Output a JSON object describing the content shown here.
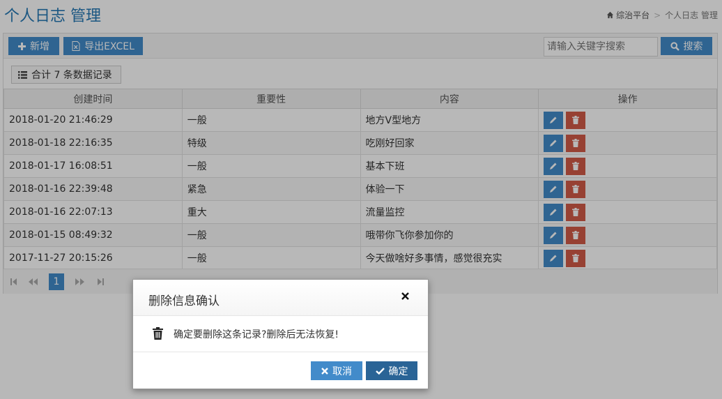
{
  "header": {
    "title": "个人日志 管理",
    "breadcrumb": {
      "home": "综治平台",
      "separator": ">",
      "current": "个人日志 管理"
    }
  },
  "toolbar": {
    "add_label": "新增",
    "export_label": "导出EXCEL",
    "search_placeholder": "请输入关键字搜索",
    "search_label": "搜索"
  },
  "record_count": "合计 7 条数据记录",
  "table": {
    "columns": [
      "创建时间",
      "重要性",
      "内容",
      "操作"
    ],
    "rows": [
      {
        "time": "2018-01-20 21:46:29",
        "importance": "一般",
        "content": "地方V型地方"
      },
      {
        "time": "2018-01-18 22:16:35",
        "importance": "特级",
        "content": "吃刚好回家"
      },
      {
        "time": "2018-01-17 16:08:51",
        "importance": "一般",
        "content": "基本下班"
      },
      {
        "time": "2018-01-16 22:39:48",
        "importance": "紧急",
        "content": "体验一下"
      },
      {
        "time": "2018-01-16 22:07:13",
        "importance": "重大",
        "content": "流量监控"
      },
      {
        "time": "2018-01-15 08:49:32",
        "importance": "一般",
        "content": "哦带你飞你参加你的"
      },
      {
        "time": "2017-11-27 20:15:26",
        "importance": "一般",
        "content": "今天做啥好多事情，感觉很充实"
      }
    ]
  },
  "pagination": {
    "current_page": "1"
  },
  "modal": {
    "title": "删除信息确认",
    "message": "确定要删除这条记录?删除后无法恢复!",
    "cancel_label": "取消",
    "confirm_label": "确定"
  },
  "colors": {
    "primary": "#428bca",
    "danger": "#d15b47",
    "confirm": "#2a6496",
    "title": "#2679b5"
  },
  "icons": {
    "add": "plus-icon",
    "export": "excel-file-icon",
    "search": "search-icon",
    "list": "list-icon",
    "edit": "pencil-icon",
    "delete": "trash-icon",
    "home": "home-icon",
    "close": "close-icon",
    "cancel": "times-icon",
    "confirm": "check-icon"
  }
}
